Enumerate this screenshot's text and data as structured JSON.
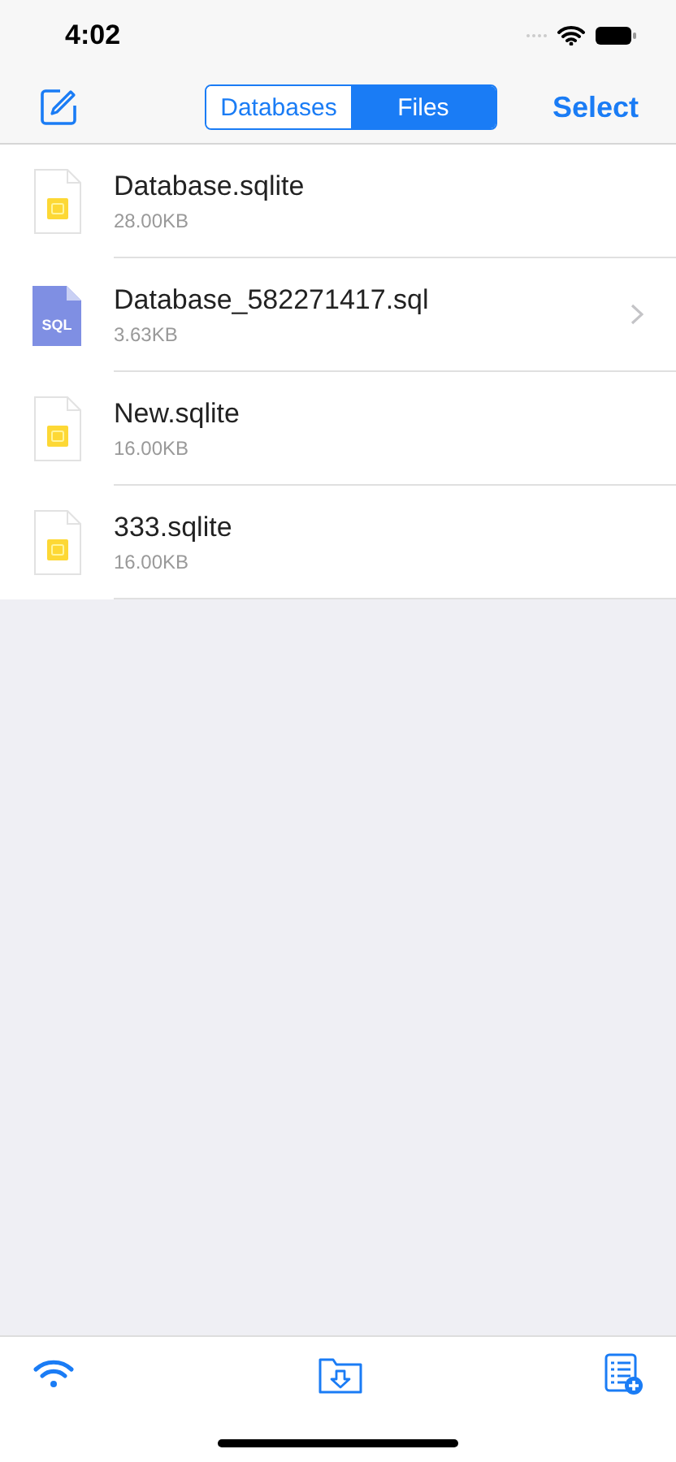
{
  "status_bar": {
    "time": "4:02"
  },
  "nav": {
    "segments": [
      {
        "label": "Databases",
        "selected": false
      },
      {
        "label": "Files",
        "selected": true
      }
    ],
    "select": "Select"
  },
  "files": [
    {
      "name": "Database.sqlite",
      "size": "28.00KB",
      "kind": "sqlite",
      "disclosure": false
    },
    {
      "name": "Database_582271417.sql",
      "size": "3.63KB",
      "kind": "sql",
      "badge": "SQL",
      "disclosure": true
    },
    {
      "name": "New.sqlite",
      "size": "16.00KB",
      "kind": "sqlite",
      "disclosure": false
    },
    {
      "name": "333.sqlite",
      "size": "16.00KB",
      "kind": "sqlite",
      "disclosure": false
    }
  ]
}
